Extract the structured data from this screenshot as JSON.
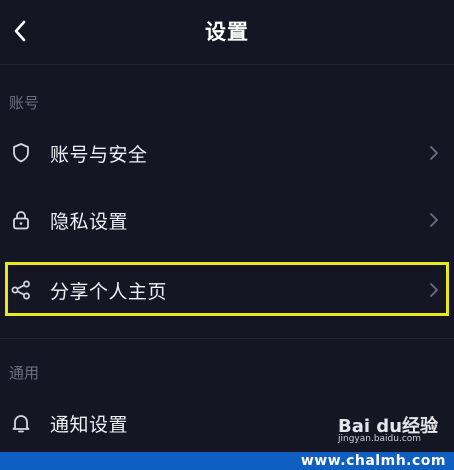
{
  "header": {
    "title": "设置"
  },
  "sections": [
    {
      "label": "账号",
      "items": [
        {
          "label": "账号与安全",
          "icon": "shield-icon"
        },
        {
          "label": "隐私设置",
          "icon": "lock-icon"
        },
        {
          "label": "分享个人主页",
          "icon": "share-icon",
          "highlighted": true
        }
      ]
    },
    {
      "label": "通用",
      "items": [
        {
          "label": "通知设置",
          "icon": "bell-icon"
        }
      ]
    }
  ],
  "watermark": {
    "logo": "Bai du经验",
    "sub": "jingyan.baidu.com"
  },
  "footer": {
    "text": "www.chalmh.com"
  },
  "colors": {
    "background": "#151624",
    "highlight": "#e8e81a",
    "footer_band": "#0f5ec2"
  }
}
